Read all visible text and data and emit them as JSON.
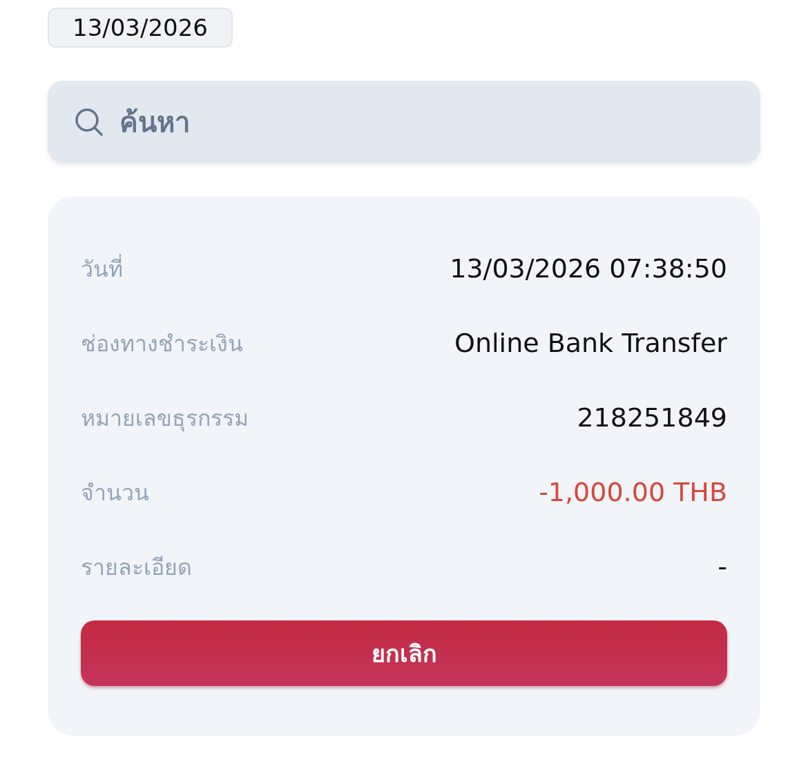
{
  "date_chip": "13/03/2026",
  "search": {
    "placeholder": "ค้นหา"
  },
  "details": [
    {
      "label": "วันที่",
      "value": "13/03/2026 07:38:50",
      "color": "#111111"
    },
    {
      "label": "ช่องทางชำระเงิน",
      "value": "Online Bank Transfer",
      "color": "#111111"
    },
    {
      "label": "หมายเลขธุรกรรม",
      "value": "218251849",
      "color": "#111111"
    },
    {
      "label": "จำนวน",
      "value": "-1,000.00 THB",
      "color": "#d9473b"
    },
    {
      "label": "รายละเอียด",
      "value": "-",
      "color": "#111111"
    }
  ],
  "cancel_button": "ยกเลิก"
}
